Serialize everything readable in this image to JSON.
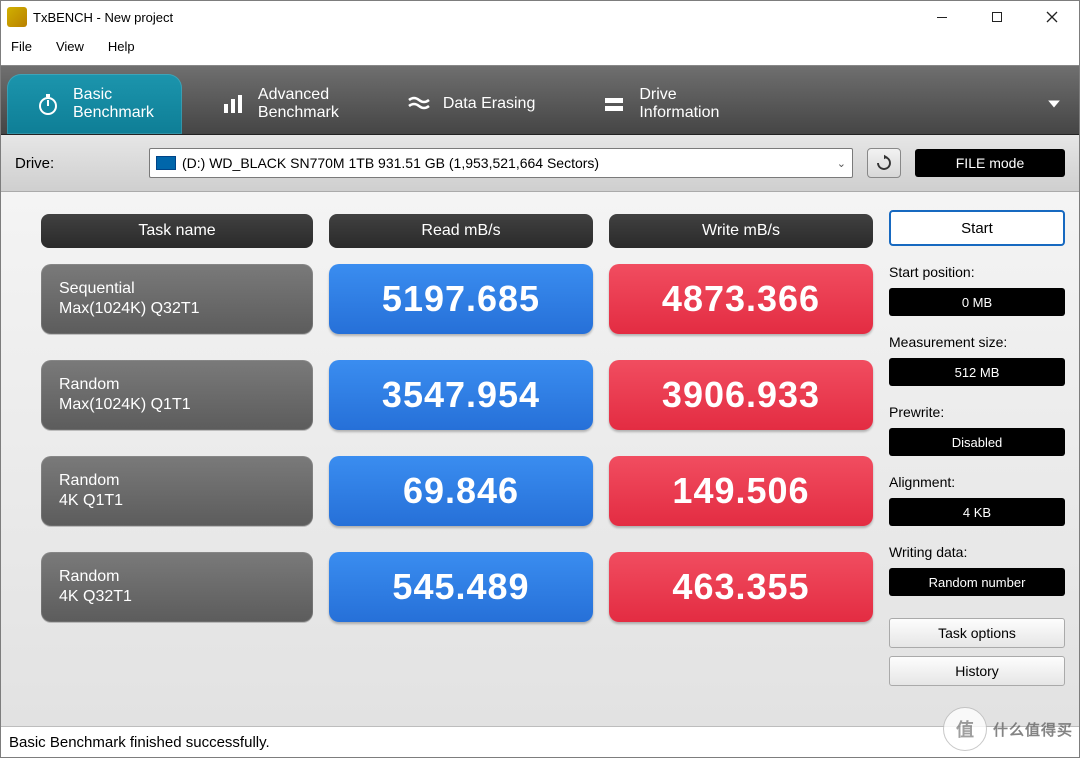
{
  "window": {
    "title": "TxBENCH - New project"
  },
  "menu": {
    "file": "File",
    "view": "View",
    "help": "Help"
  },
  "tabs": {
    "basic": {
      "l1": "Basic",
      "l2": "Benchmark"
    },
    "advanced": {
      "l1": "Advanced",
      "l2": "Benchmark"
    },
    "erasing": {
      "l1": "Data Erasing",
      "l2": ""
    },
    "driveinfo": {
      "l1": "Drive",
      "l2": "Information"
    }
  },
  "drive": {
    "label": "Drive:",
    "selected": "(D:) WD_BLACK SN770M 1TB  931.51 GB (1,953,521,664 Sectors)",
    "filemode": "FILE mode"
  },
  "headers": {
    "task": "Task name",
    "read": "Read mB/s",
    "write": "Write mB/s"
  },
  "rows": [
    {
      "name_l1": "Sequential",
      "name_l2": "Max(1024K) Q32T1",
      "read": "5197.685",
      "write": "4873.366"
    },
    {
      "name_l1": "Random",
      "name_l2": "Max(1024K) Q1T1",
      "read": "3547.954",
      "write": "3906.933"
    },
    {
      "name_l1": "Random",
      "name_l2": "4K Q1T1",
      "read": "69.846",
      "write": "149.506"
    },
    {
      "name_l1": "Random",
      "name_l2": "4K Q32T1",
      "read": "545.489",
      "write": "463.355"
    }
  ],
  "sidebar": {
    "start": "Start",
    "start_pos_label": "Start position:",
    "start_pos_value": "0 MB",
    "meas_label": "Measurement size:",
    "meas_value": "512 MB",
    "prewrite_label": "Prewrite:",
    "prewrite_value": "Disabled",
    "align_label": "Alignment:",
    "align_value": "4 KB",
    "wdata_label": "Writing data:",
    "wdata_value": "Random number",
    "task_options": "Task options",
    "history": "History"
  },
  "status": "Basic Benchmark finished successfully.",
  "watermark": {
    "char": "值",
    "text": "什么值得买"
  }
}
